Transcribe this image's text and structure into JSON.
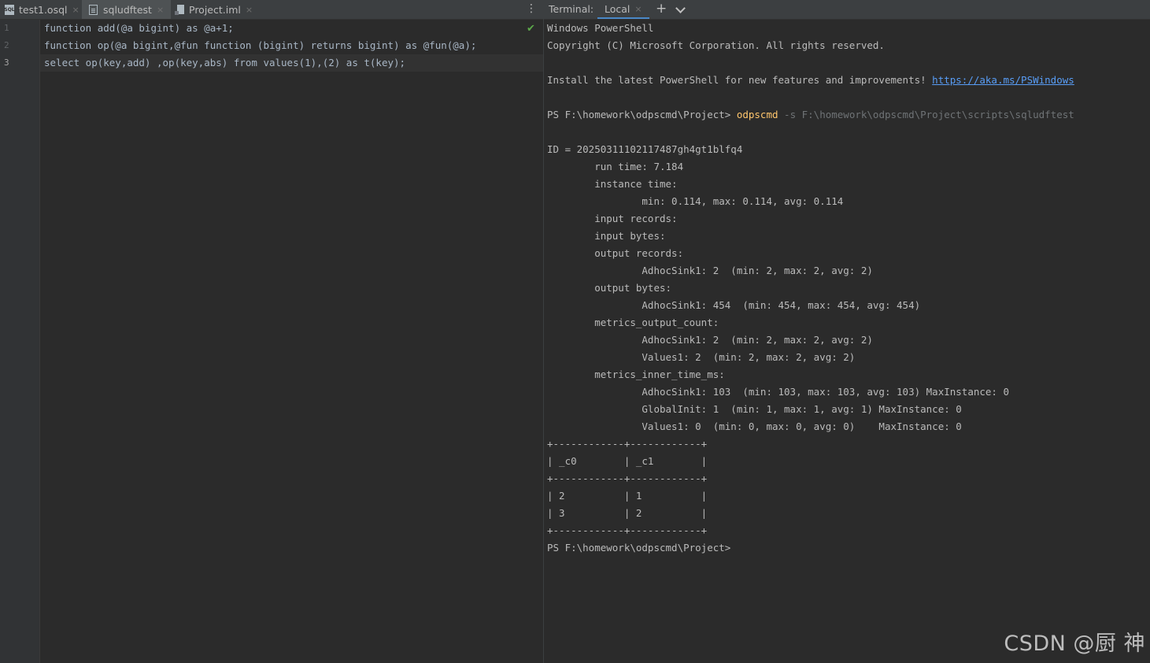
{
  "editor": {
    "tabs": [
      {
        "label": "test1.osql",
        "icon": "sql-file-icon"
      },
      {
        "label": "sqludftest",
        "icon": "text-file-icon"
      },
      {
        "label": "Project.iml",
        "icon": "iml-file-icon"
      }
    ],
    "active_tab": "sqludftest",
    "more_icon": "⋮",
    "line_numbers": [
      "1",
      "2",
      "3"
    ],
    "lines": [
      "function add(@a bigint) as @a+1;",
      "function op(@a bigint,@fun function (bigint) returns bigint) as @fun(@a);",
      "select op(key,add) ,op(key,abs) from values(1),(2) as t(key);"
    ],
    "status_icon": "✔"
  },
  "terminal": {
    "label": "Terminal:",
    "tab": "Local",
    "close_glyph": "×",
    "add_glyph": "+",
    "lines": [
      "Windows PowerShell",
      "Copyright (C) Microsoft Corporation. All rights reserved.",
      "",
      "Install the latest PowerShell for new features and improvements! ",
      "",
      "PS F:\\homework\\odpscmd\\Project> ",
      "",
      "ID = 20250311102117487gh4gt1blfq4",
      "        run time: 7.184",
      "        instance time:",
      "                min: 0.114, max: 0.114, avg: 0.114",
      "        input records:",
      "        input bytes:",
      "        output records:",
      "                AdhocSink1: 2  (min: 2, max: 2, avg: 2)",
      "        output bytes:",
      "                AdhocSink1: 454  (min: 454, max: 454, avg: 454)",
      "        metrics_output_count:",
      "                AdhocSink1: 2  (min: 2, max: 2, avg: 2)",
      "                Values1: 2  (min: 2, max: 2, avg: 2)",
      "        metrics_inner_time_ms:",
      "                AdhocSink1: 103  (min: 103, max: 103, avg: 103) MaxInstance: 0",
      "                GlobalInit: 1  (min: 1, max: 1, avg: 1) MaxInstance: 0",
      "                Values1: 0  (min: 0, max: 0, avg: 0)    MaxInstance: 0",
      "+------------+------------+",
      "| _c0        | _c1        |",
      "+------------+------------+",
      "| 2          | 1          |",
      "| 3          | 2          |",
      "+------------+------------+",
      "PS F:\\homework\\odpscmd\\Project>"
    ],
    "link": "https://aka.ms/PSWindows",
    "command": "odpscmd",
    "command_args": " -s F:\\homework\\odpscmd\\Project\\scripts\\sqludftest"
  },
  "watermark": "CSDN @厨 神",
  "colors": {
    "accent": "#4a88c7",
    "link": "#589df6",
    "command": "#ffc66d",
    "check": "#5ca94a"
  }
}
